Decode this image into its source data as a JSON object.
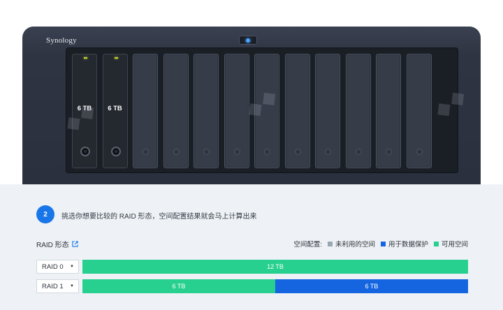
{
  "device": {
    "brand": "Synology",
    "bays": [
      {
        "state": "filled",
        "capacity": "6 TB"
      },
      {
        "state": "filled",
        "capacity": "6 TB"
      },
      {
        "state": "empty"
      },
      {
        "state": "empty"
      },
      {
        "state": "empty"
      },
      {
        "state": "empty"
      },
      {
        "state": "empty"
      },
      {
        "state": "empty"
      },
      {
        "state": "empty"
      },
      {
        "state": "empty"
      },
      {
        "state": "empty"
      },
      {
        "state": "empty"
      }
    ],
    "colors": {
      "body": "#2e3442",
      "led_power": "#4aa3ff",
      "led_drive": "#c6d83c"
    }
  },
  "step": {
    "number": "2",
    "instruction": "挑选你想要比较的 RAID 形态，空间配置结果就会马上计算出来"
  },
  "raid_section": {
    "title": "RAID 形态",
    "legend_label": "空间配置:",
    "legend": [
      {
        "label": "未利用的空间",
        "color": "#9aa6b2"
      },
      {
        "label": "用于数据保护",
        "color": "#1565e0"
      },
      {
        "label": "可用空间",
        "color": "#28d08f"
      }
    ],
    "rows": [
      {
        "select_value": "RAID 0",
        "segments": [
          {
            "label": "12 TB",
            "kind": "green",
            "fraction": 1.0
          }
        ]
      },
      {
        "select_value": "RAID 1",
        "segments": [
          {
            "label": "6 TB",
            "kind": "green",
            "fraction": 0.5
          },
          {
            "label": "6 TB",
            "kind": "blue",
            "fraction": 0.5
          }
        ]
      }
    ]
  },
  "colors": {
    "accent": "#1976e8",
    "panel_bg": "#eef2f6"
  }
}
